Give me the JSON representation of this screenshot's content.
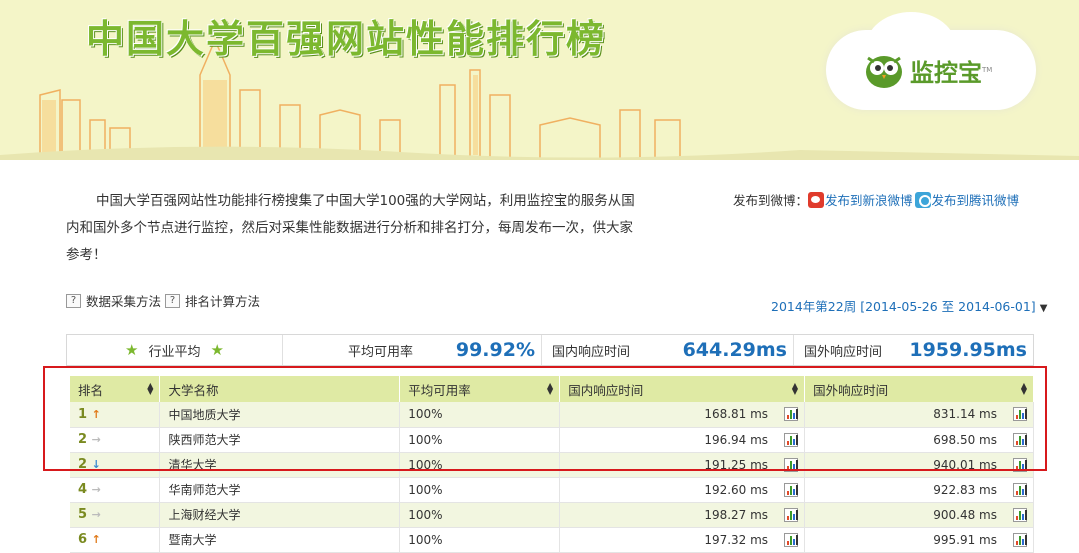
{
  "banner": {
    "title": "中国大学百强网站性能排行榜",
    "logo_text": "监控宝",
    "logo_tm": "TM"
  },
  "intro": {
    "text": "中国大学百强网站性功能排行榜搜集了中国大学100强的大学网站，利用监控宝的服务从国内和国外多个节点进行监控，然后对采集性能数据进行分析和排名打分，每周发布一次，供大家参考！"
  },
  "share": {
    "label": "发布到微博：",
    "sina": "发布到新浪微博",
    "tencent": "发布到腾讯微博"
  },
  "methods": {
    "data_method": "数据采集方法",
    "rank_method": "排名计算方法"
  },
  "week": {
    "text": "2014年第22周 [2014-05-26 至 2014-06-01]",
    "caret": "▼"
  },
  "average": {
    "label": "行业平均",
    "availability_label": "平均可用率",
    "availability_value": "99.92%",
    "domestic_label": "国内响应时间",
    "domestic_value": "644.29ms",
    "foreign_label": "国外响应时间",
    "foreign_value": "1959.95ms"
  },
  "table": {
    "headers": [
      "排名",
      "大学名称",
      "平均可用率",
      "国内响应时间",
      "国外响应时间"
    ],
    "rows": [
      {
        "rank": "1",
        "trend": "up",
        "name": "中国地质大学",
        "avail": "100%",
        "domestic": "168.81 ms",
        "foreign": "831.14 ms"
      },
      {
        "rank": "2",
        "trend": "same",
        "name": "陕西师范大学",
        "avail": "100%",
        "domestic": "196.94 ms",
        "foreign": "698.50 ms"
      },
      {
        "rank": "2",
        "trend": "down",
        "name": "清华大学",
        "avail": "100%",
        "domestic": "191.25 ms",
        "foreign": "940.01 ms"
      },
      {
        "rank": "4",
        "trend": "same",
        "name": "华南师范大学",
        "avail": "100%",
        "domestic": "192.60 ms",
        "foreign": "922.83 ms"
      },
      {
        "rank": "5",
        "trend": "same",
        "name": "上海财经大学",
        "avail": "100%",
        "domestic": "198.27 ms",
        "foreign": "900.48 ms"
      },
      {
        "rank": "6",
        "trend": "up",
        "name": "暨南大学",
        "avail": "100%",
        "domestic": "197.32 ms",
        "foreign": "995.91 ms"
      }
    ]
  },
  "colors": {
    "accent_green": "#7cb82f",
    "link_blue": "#1e6fb8",
    "header_bg": "#dfeaa4",
    "highlight_red": "#d7191c"
  }
}
